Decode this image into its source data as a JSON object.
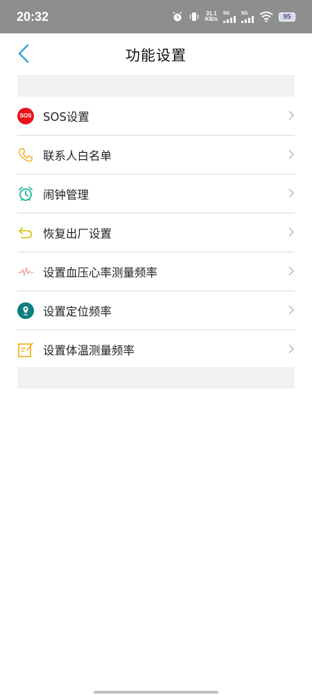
{
  "status_bar": {
    "time": "20:32",
    "net_speed_value": "31.1",
    "net_speed_unit": "KB/s",
    "sim1_label": "5G",
    "sim2_label": "5G",
    "battery": "95",
    "icons": [
      "alarm-icon",
      "vibrate-icon",
      "signal-icon",
      "signal-icon",
      "wifi-icon",
      "battery-icon"
    ]
  },
  "header": {
    "title": "功能设置",
    "back_icon": "back-chevron-icon"
  },
  "menu": {
    "items": [
      {
        "label": "SOS设置",
        "icon": "sos-icon",
        "icon_text": "SOS",
        "icon_color": "#e8141b"
      },
      {
        "label": "联系人白名单",
        "icon": "phone-icon",
        "icon_color": "#f0b323"
      },
      {
        "label": "闹钟管理",
        "icon": "alarm-clock-icon",
        "icon_color": "#1fb39a"
      },
      {
        "label": "恢复出厂设置",
        "icon": "undo-icon",
        "icon_color": "#d6c21a"
      },
      {
        "label": "设置血压心率测量频率",
        "icon": "heartbeat-icon",
        "icon_color": "#e8a0a0"
      },
      {
        "label": "设置定位频率",
        "icon": "location-icon",
        "icon_color": "#0f7d7d"
      },
      {
        "label": "设置体温测量频率",
        "icon": "note-edit-icon",
        "icon_color": "#f0b323"
      }
    ]
  },
  "colors": {
    "accent": "#3aa0d8",
    "status_bar_bg": "#8e8e8e",
    "band_bg": "#f1f1f1",
    "divider": "#d9d9d9"
  }
}
